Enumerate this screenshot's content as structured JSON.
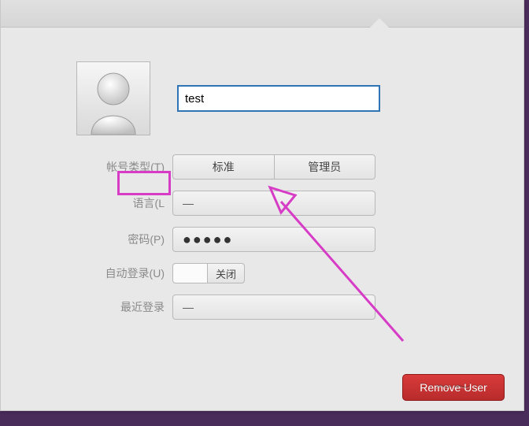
{
  "user": {
    "name_value": "test"
  },
  "fields": {
    "account_type": {
      "label": "帐号类型(T)",
      "options": {
        "standard": "标准",
        "admin": "管理员"
      }
    },
    "language": {
      "label": "语言(L",
      "value": "—"
    },
    "password": {
      "label": "密码(P)",
      "masked_value": "●●●●●"
    },
    "auto_login": {
      "label": "自动登录(U)",
      "state_text": "关闭"
    },
    "last_login": {
      "label": "最近登录",
      "value": "—"
    }
  },
  "buttons": {
    "remove_user": "Remove User"
  },
  "annotation": {
    "highlight_color": "#d63cc5"
  }
}
